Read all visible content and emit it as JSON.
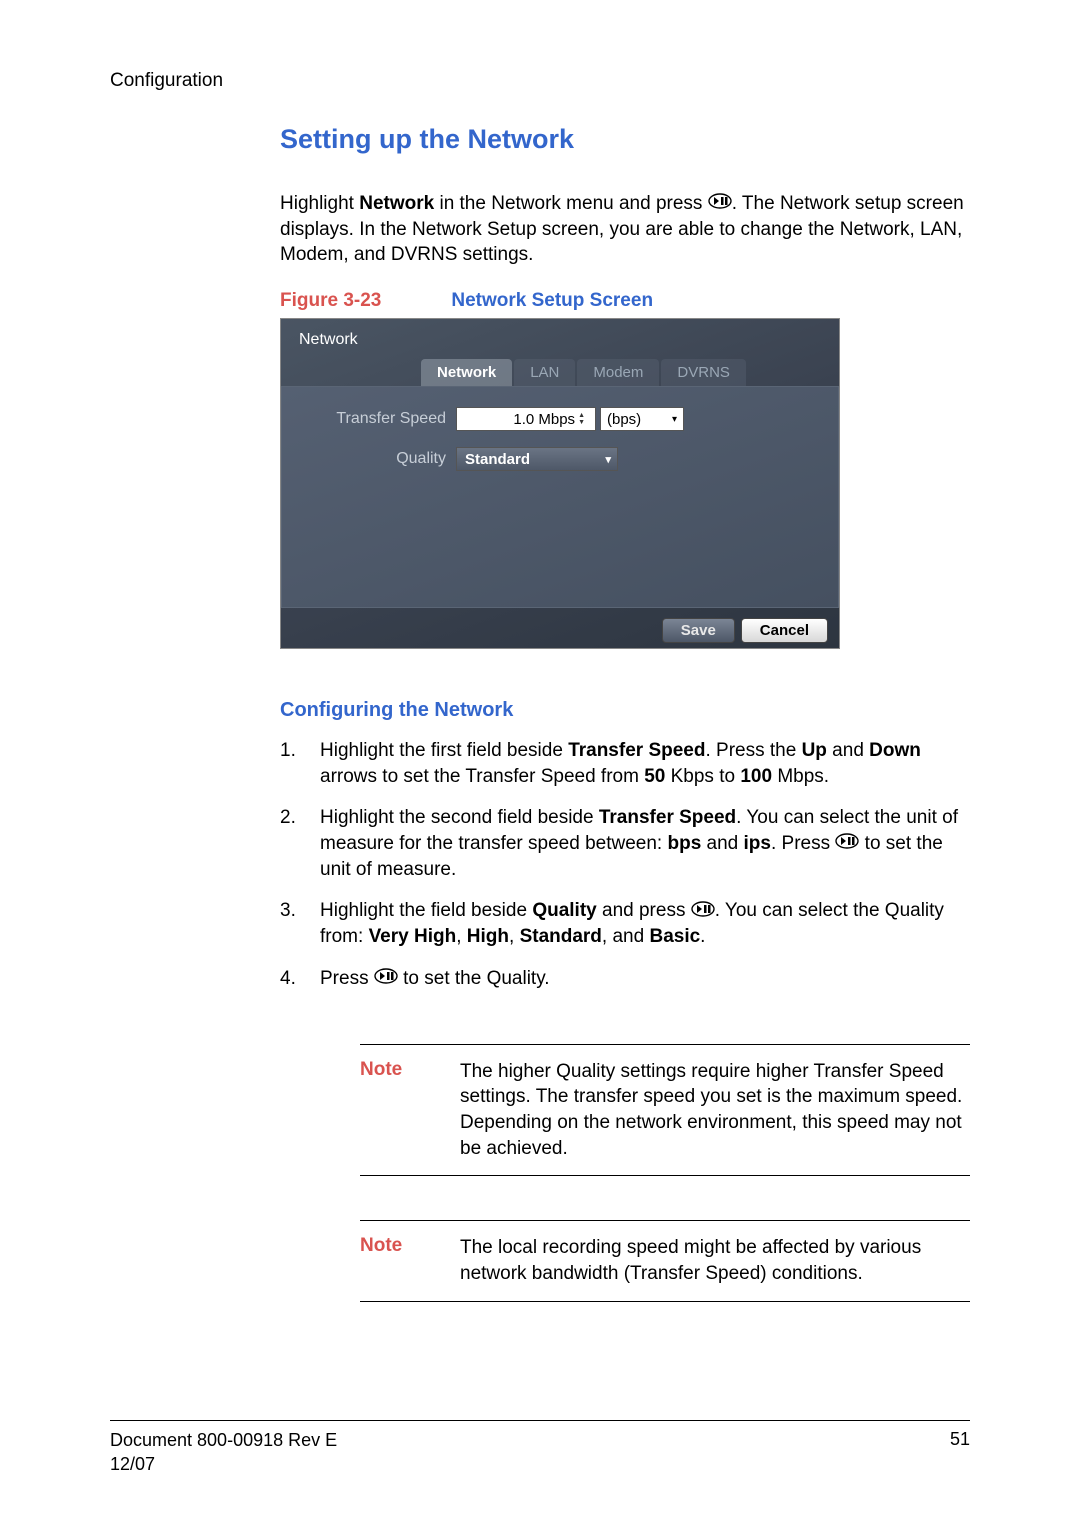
{
  "header": {
    "section_label": "Configuration"
  },
  "title": "Setting up the Network",
  "intro": {
    "part1": "Highlight ",
    "bold1": "Network",
    "part2": " in the Network menu and press ",
    "part3": ". The Network setup screen displays. In the Network Setup screen, you are able to change the Network, LAN, Modem, and DVRNS settings."
  },
  "figure": {
    "label": "Figure 3-23",
    "title": "Network Setup Screen"
  },
  "screenshot": {
    "title": "Network",
    "tabs": [
      "Network",
      "LAN",
      "Modem",
      "DVRNS"
    ],
    "transfer_label": "Transfer Speed",
    "transfer_value": "1.0 Mbps",
    "unit_value": "(bps)",
    "quality_label": "Quality",
    "quality_value": "Standard",
    "save_label": "Save",
    "cancel_label": "Cancel"
  },
  "subsection": "Configuring the Network",
  "steps": {
    "s1": {
      "p1": "Highlight the first field beside ",
      "b1": "Transfer Speed",
      "p2": ". Press the ",
      "b2": "Up",
      "p3": " and ",
      "b3": "Down",
      "p4": " arrows to set the Transfer Speed from ",
      "b4": "50",
      "p5": " Kbps to ",
      "b5": "100",
      "p6": " Mbps."
    },
    "s2": {
      "p1": "Highlight the second field beside ",
      "b1": "Transfer Speed",
      "p2": ". You can select the unit of measure for the transfer speed between: ",
      "b2": "bps",
      "p3": " and ",
      "b3": "ips",
      "p4": ". Press ",
      "p5": " to set the unit of measure."
    },
    "s3": {
      "p1": "Highlight the field beside ",
      "b1": "Quality",
      "p2": " and press ",
      "p3": ". You can select the Quality from: ",
      "b2": "Very High",
      "c1": ", ",
      "b3": "High",
      "c2": ", ",
      "b4": "Standard",
      "c3": ", and ",
      "b5": "Basic",
      "c4": "."
    },
    "s4": {
      "p1": "Press ",
      "p2": " to set the Quality."
    }
  },
  "notes": {
    "label": "Note",
    "n1": "The higher Quality settings require higher Transfer Speed settings. The transfer speed you set is the maximum speed. Depending on the network environment, this speed may not be achieved.",
    "n2": "The local recording speed might be affected by various network bandwidth (Transfer Speed) conditions."
  },
  "footer": {
    "doc": "Document 800-00918 Rev E",
    "date": "12/07",
    "page": "51"
  }
}
